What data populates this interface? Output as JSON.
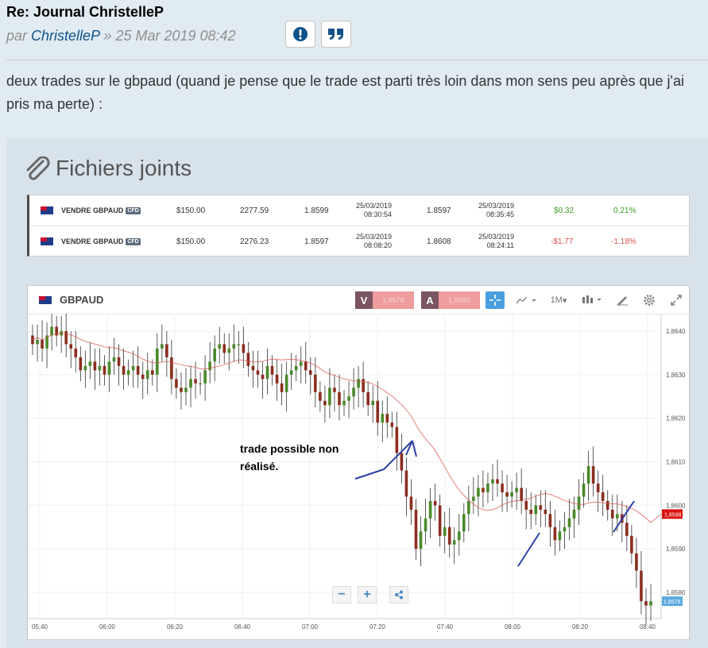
{
  "post": {
    "title": "Re: Journal ChristelleP",
    "prefix": "par",
    "author": "ChristelleP",
    "separator": "»",
    "date": "25 Mar 2019 08:42",
    "body": "deux trades sur le gbpaud (quand je pense que le trade est parti très loin dans mon sens peu après que j'ai pris ma perte) :"
  },
  "attachments": {
    "heading": "Fichiers joints"
  },
  "trades": [
    {
      "action": "VENDRE GBPAUD",
      "tag": "CFD",
      "amount": "$150.00",
      "units": "2277.59",
      "open_rate": "1.8599",
      "open_date": "25/03/2019",
      "open_time": "08:30:54",
      "close_rate": "1.8597",
      "close_date": "25/03/2019",
      "close_time": "08:35:45",
      "pl": "$0.32",
      "pl_pct": "0.21%",
      "result": "gain"
    },
    {
      "action": "VENDRE GBPAUD",
      "tag": "CFD",
      "amount": "$150.00",
      "units": "2276.23",
      "open_rate": "1.8597",
      "open_date": "25/03/2019",
      "open_time": "08:08:20",
      "close_rate": "1.8608",
      "close_date": "25/03/2019",
      "close_time": "08:24:11",
      "pl": "-$1.77",
      "pl_pct": "-1.18%",
      "result": "loss"
    }
  ],
  "chart_toolbar": {
    "symbol": "GBPAUD",
    "sell_letter": "V",
    "buy_letter": "A",
    "sell_value": "1,8578",
    "buy_value": "1,8580",
    "timeframe": "1M",
    "icons": [
      "crosshair-icon",
      "chart-type-icon",
      "candles-icon",
      "draw-icon",
      "gear-icon",
      "fullscreen-icon"
    ]
  },
  "annotation": {
    "line1": "trade possible non",
    "line2": "réalisé."
  },
  "chart_data": {
    "type": "candlestick",
    "symbol": "GBPAUD",
    "x_tick_labels": [
      "05:40",
      "06:00",
      "06:20",
      "06:40",
      "07:00",
      "07:20",
      "07:40",
      "08:00",
      "08:20",
      "08:40"
    ],
    "y_tick_labels": [
      "1,8640",
      "1,8630",
      "1,8620",
      "1,8610",
      "1,8600",
      "1,8590",
      "1,8580"
    ],
    "ylim": [
      1.8574,
      1.8644
    ],
    "current_price": "1,8578",
    "ma_marker": "1,8598",
    "close_series": [
      1.8637,
      1.8638,
      1.8636,
      1.8639,
      1.8641,
      1.8639,
      1.864,
      1.8637,
      1.8636,
      1.8634,
      1.8631,
      1.8632,
      1.8633,
      1.8631,
      1.8632,
      1.863,
      1.8633,
      1.8634,
      1.8632,
      1.863,
      1.8631,
      1.8632,
      1.863,
      1.8629,
      1.8631,
      1.863,
      1.8636,
      1.8637,
      1.8634,
      1.8629,
      1.8627,
      1.8626,
      1.8627,
      1.8629,
      1.8628,
      1.8628,
      1.8631,
      1.8633,
      1.8636,
      1.8637,
      1.8635,
      1.8636,
      1.8637,
      1.8637,
      1.8635,
      1.8632,
      1.8631,
      1.863,
      1.8629,
      1.8632,
      1.863,
      1.8628,
      1.8626,
      1.863,
      1.8631,
      1.8632,
      1.8633,
      1.8631,
      1.863,
      1.8626,
      1.8624,
      1.8623,
      1.8627,
      1.8626,
      1.8623,
      1.8624,
      1.8625,
      1.8627,
      1.8629,
      1.8626,
      1.8623,
      1.8624,
      1.8619,
      1.8621,
      1.8619,
      1.8618,
      1.8612,
      1.8608,
      1.8602,
      1.8599,
      1.859,
      1.8594,
      1.8597,
      1.8601,
      1.86,
      1.8593,
      1.8595,
      1.8591,
      1.8592,
      1.8594,
      1.8598,
      1.8601,
      1.8602,
      1.8604,
      1.8603,
      1.8605,
      1.8606,
      1.8605,
      1.8603,
      1.8602,
      1.8603,
      1.8604,
      1.8601,
      1.8599,
      1.8598,
      1.86,
      1.8599,
      1.8598,
      1.8595,
      1.8592,
      1.8594,
      1.8595,
      1.8597,
      1.8599,
      1.8602,
      1.8605,
      1.8609,
      1.8605,
      1.8603,
      1.8601,
      1.8599,
      1.8597,
      1.8598,
      1.8596,
      1.8593,
      1.8589,
      1.8585,
      1.8578,
      1.8577,
      1.8578
    ]
  }
}
